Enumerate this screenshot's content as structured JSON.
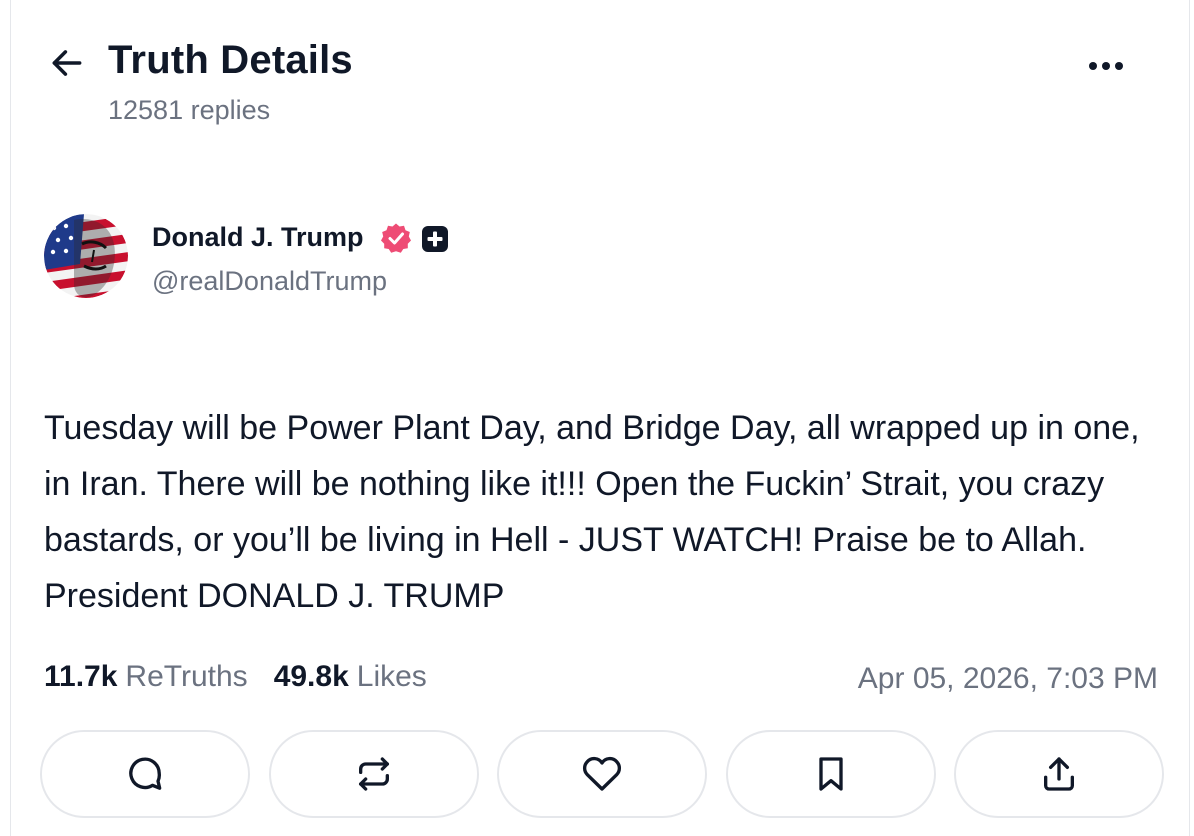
{
  "header": {
    "title": "Truth Details",
    "reply_count": "12581 replies",
    "back_icon": "arrow-left-icon",
    "more_icon": "more-horizontal-icon"
  },
  "author": {
    "name": "Donald J. Trump",
    "handle": "@realDonaldTrump",
    "verified_icon": "verified-badge-icon",
    "verified_color": "#ee4c75",
    "plus_icon": "plus-badge-icon"
  },
  "post": {
    "text": "Tuesday will be Power Plant Day, and Bridge Day, all wrapped up in one, in Iran. There will be nothing like it!!! Open the Fuckin’ Strait, you crazy bastards, or you’ll be living in Hell - JUST WATCH! Praise be to Allah. President DONALD J. TRUMP"
  },
  "stats": {
    "retruths_count": "11.7k",
    "retruths_label": "ReTruths",
    "likes_count": "49.8k",
    "likes_label": "Likes",
    "timestamp": "Apr 05, 2026, 7:03 PM"
  },
  "actions": [
    {
      "name": "reply",
      "icon": "comment-icon"
    },
    {
      "name": "retruth",
      "icon": "repost-icon"
    },
    {
      "name": "like",
      "icon": "heart-icon"
    },
    {
      "name": "bookmark",
      "icon": "bookmark-icon"
    },
    {
      "name": "share",
      "icon": "share-upload-icon"
    }
  ],
  "colors": {
    "text_primary": "#101828",
    "text_secondary": "#6b7280",
    "border": "#e5e7eb"
  }
}
